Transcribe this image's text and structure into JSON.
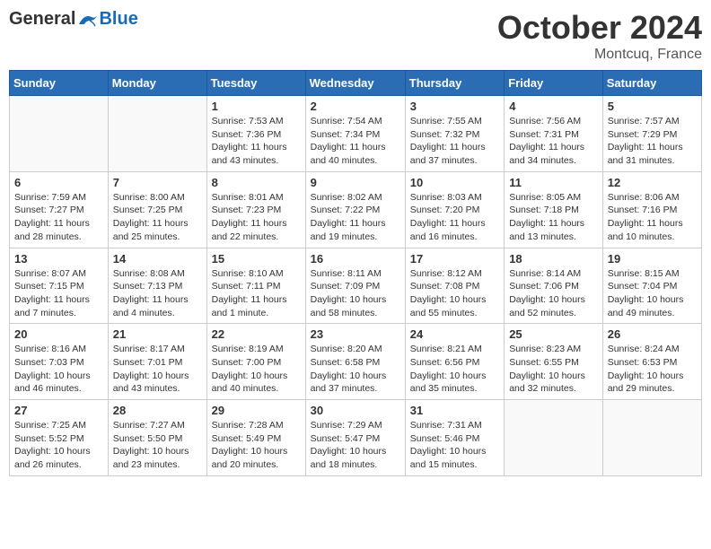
{
  "header": {
    "logo_general": "General",
    "logo_blue": "Blue",
    "month": "October 2024",
    "location": "Montcuq, France"
  },
  "days_of_week": [
    "Sunday",
    "Monday",
    "Tuesday",
    "Wednesday",
    "Thursday",
    "Friday",
    "Saturday"
  ],
  "weeks": [
    [
      {
        "day": "",
        "info": ""
      },
      {
        "day": "",
        "info": ""
      },
      {
        "day": "1",
        "info": "Sunrise: 7:53 AM\nSunset: 7:36 PM\nDaylight: 11 hours and 43 minutes."
      },
      {
        "day": "2",
        "info": "Sunrise: 7:54 AM\nSunset: 7:34 PM\nDaylight: 11 hours and 40 minutes."
      },
      {
        "day": "3",
        "info": "Sunrise: 7:55 AM\nSunset: 7:32 PM\nDaylight: 11 hours and 37 minutes."
      },
      {
        "day": "4",
        "info": "Sunrise: 7:56 AM\nSunset: 7:31 PM\nDaylight: 11 hours and 34 minutes."
      },
      {
        "day": "5",
        "info": "Sunrise: 7:57 AM\nSunset: 7:29 PM\nDaylight: 11 hours and 31 minutes."
      }
    ],
    [
      {
        "day": "6",
        "info": "Sunrise: 7:59 AM\nSunset: 7:27 PM\nDaylight: 11 hours and 28 minutes."
      },
      {
        "day": "7",
        "info": "Sunrise: 8:00 AM\nSunset: 7:25 PM\nDaylight: 11 hours and 25 minutes."
      },
      {
        "day": "8",
        "info": "Sunrise: 8:01 AM\nSunset: 7:23 PM\nDaylight: 11 hours and 22 minutes."
      },
      {
        "day": "9",
        "info": "Sunrise: 8:02 AM\nSunset: 7:22 PM\nDaylight: 11 hours and 19 minutes."
      },
      {
        "day": "10",
        "info": "Sunrise: 8:03 AM\nSunset: 7:20 PM\nDaylight: 11 hours and 16 minutes."
      },
      {
        "day": "11",
        "info": "Sunrise: 8:05 AM\nSunset: 7:18 PM\nDaylight: 11 hours and 13 minutes."
      },
      {
        "day": "12",
        "info": "Sunrise: 8:06 AM\nSunset: 7:16 PM\nDaylight: 11 hours and 10 minutes."
      }
    ],
    [
      {
        "day": "13",
        "info": "Sunrise: 8:07 AM\nSunset: 7:15 PM\nDaylight: 11 hours and 7 minutes."
      },
      {
        "day": "14",
        "info": "Sunrise: 8:08 AM\nSunset: 7:13 PM\nDaylight: 11 hours and 4 minutes."
      },
      {
        "day": "15",
        "info": "Sunrise: 8:10 AM\nSunset: 7:11 PM\nDaylight: 11 hours and 1 minute."
      },
      {
        "day": "16",
        "info": "Sunrise: 8:11 AM\nSunset: 7:09 PM\nDaylight: 10 hours and 58 minutes."
      },
      {
        "day": "17",
        "info": "Sunrise: 8:12 AM\nSunset: 7:08 PM\nDaylight: 10 hours and 55 minutes."
      },
      {
        "day": "18",
        "info": "Sunrise: 8:14 AM\nSunset: 7:06 PM\nDaylight: 10 hours and 52 minutes."
      },
      {
        "day": "19",
        "info": "Sunrise: 8:15 AM\nSunset: 7:04 PM\nDaylight: 10 hours and 49 minutes."
      }
    ],
    [
      {
        "day": "20",
        "info": "Sunrise: 8:16 AM\nSunset: 7:03 PM\nDaylight: 10 hours and 46 minutes."
      },
      {
        "day": "21",
        "info": "Sunrise: 8:17 AM\nSunset: 7:01 PM\nDaylight: 10 hours and 43 minutes."
      },
      {
        "day": "22",
        "info": "Sunrise: 8:19 AM\nSunset: 7:00 PM\nDaylight: 10 hours and 40 minutes."
      },
      {
        "day": "23",
        "info": "Sunrise: 8:20 AM\nSunset: 6:58 PM\nDaylight: 10 hours and 37 minutes."
      },
      {
        "day": "24",
        "info": "Sunrise: 8:21 AM\nSunset: 6:56 PM\nDaylight: 10 hours and 35 minutes."
      },
      {
        "day": "25",
        "info": "Sunrise: 8:23 AM\nSunset: 6:55 PM\nDaylight: 10 hours and 32 minutes."
      },
      {
        "day": "26",
        "info": "Sunrise: 8:24 AM\nSunset: 6:53 PM\nDaylight: 10 hours and 29 minutes."
      }
    ],
    [
      {
        "day": "27",
        "info": "Sunrise: 7:25 AM\nSunset: 5:52 PM\nDaylight: 10 hours and 26 minutes."
      },
      {
        "day": "28",
        "info": "Sunrise: 7:27 AM\nSunset: 5:50 PM\nDaylight: 10 hours and 23 minutes."
      },
      {
        "day": "29",
        "info": "Sunrise: 7:28 AM\nSunset: 5:49 PM\nDaylight: 10 hours and 20 minutes."
      },
      {
        "day": "30",
        "info": "Sunrise: 7:29 AM\nSunset: 5:47 PM\nDaylight: 10 hours and 18 minutes."
      },
      {
        "day": "31",
        "info": "Sunrise: 7:31 AM\nSunset: 5:46 PM\nDaylight: 10 hours and 15 minutes."
      },
      {
        "day": "",
        "info": ""
      },
      {
        "day": "",
        "info": ""
      }
    ]
  ]
}
